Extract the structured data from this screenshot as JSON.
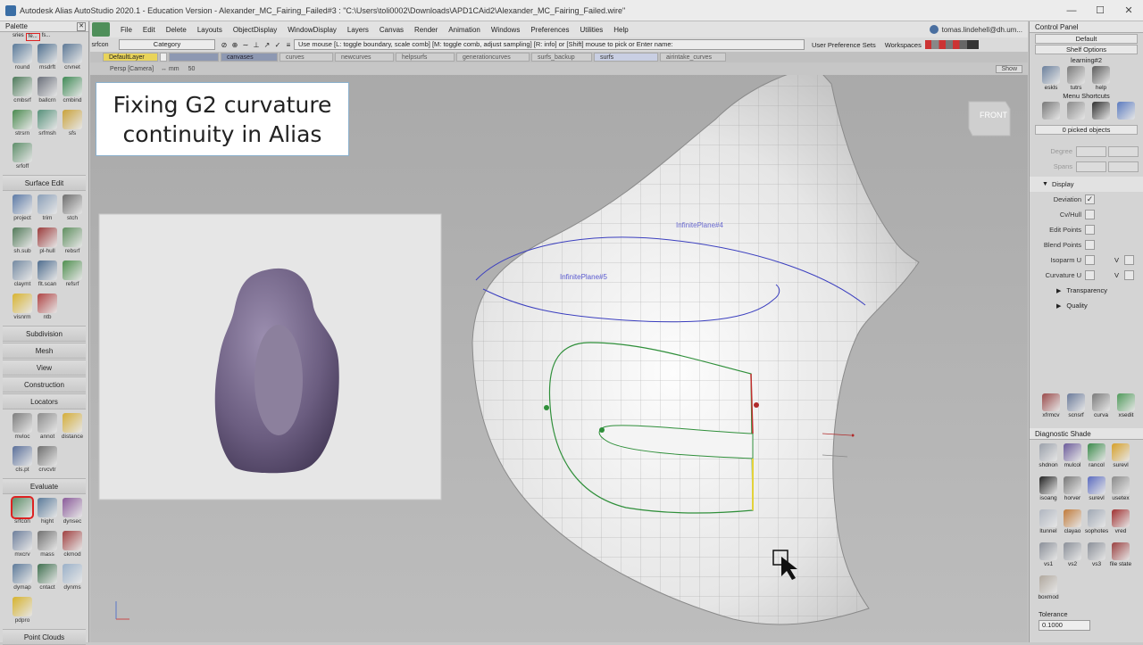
{
  "window": {
    "title": "Autodesk Alias AutoStudio 2020.1 - Education Version   - Alexander_MC_Fairing_Failed#3 : \"C:\\Users\\toli0002\\Downloads\\APD1CAid2\\Alexander_MC_Fairing_Failed.wire\"",
    "controls": [
      "—",
      "☐",
      "✕"
    ]
  },
  "menubar": {
    "items": [
      "File",
      "Edit",
      "Delete",
      "Layouts",
      "ObjectDisplay",
      "WindowDisplay",
      "Layers",
      "Canvas",
      "Render",
      "Animation",
      "Windows",
      "Preferences",
      "Utilities",
      "Help"
    ],
    "user": "tomas.lindehell@dh.um..."
  },
  "status": {
    "tool_label": "srfcon",
    "category": "Category",
    "prompt": "Use mouse [L: toggle boundary, scale comb] [M: toggle comb, adjust sampling] [R: info] or [Shift] mouse to pick or Enter name:",
    "user_prefs": "User Preference Sets",
    "workspaces": "Workspaces"
  },
  "layers": {
    "items": [
      "DefaultLayer",
      "",
      "canvases",
      "curves",
      "newcurves",
      "helpsurfs",
      "generationcurves",
      "surfs_backup",
      "surfs",
      "airintake_curves"
    ]
  },
  "viewport": {
    "name": "Persp [Camera]",
    "units": "↔ mm",
    "zoom": "50",
    "show": "Show",
    "view_cube": "FRONT",
    "plane_labels": [
      "InfinitePlane#4",
      "InfinitePlane#5"
    ],
    "caption": "Fixing G2 curvature\ncontinuity in Alias"
  },
  "palette": {
    "title": "Palette",
    "top_tabs": [
      "sries",
      "fe...",
      "fs..."
    ],
    "group1": [
      {
        "label": "round",
        "color": "#5a7a9a"
      },
      {
        "label": "msdrft",
        "color": "#4f6f8f"
      },
      {
        "label": "crvnet",
        "color": "#5c7896"
      },
      {
        "label": "cmbsrf",
        "color": "#4d7a5a"
      },
      {
        "label": "ballcrn",
        "color": "#6a6f7a"
      },
      {
        "label": "cmbind",
        "color": "#3f8a55"
      },
      {
        "label": "strsrn",
        "color": "#4a8a4f"
      },
      {
        "label": "srfmsh",
        "color": "#56917a"
      },
      {
        "label": "sfs",
        "color": "#c9a23a"
      },
      {
        "label": "srfoff",
        "color": "#5e8f6a"
      }
    ],
    "sections": [
      "Surface Edit",
      "Subdivision",
      "Mesh",
      "View",
      "Construction",
      "Locators",
      "Evaluate",
      "Point Clouds"
    ],
    "surface_edit": [
      {
        "label": "project",
        "color": "#5b79a6"
      },
      {
        "label": "trim",
        "color": "#8a9fb8"
      },
      {
        "label": "stch",
        "color": "#6d6d6d"
      },
      {
        "label": "sh.sub",
        "color": "#527a59"
      },
      {
        "label": "pl-hull",
        "color": "#9b3b3b"
      },
      {
        "label": "rebsrf",
        "color": "#5f8f5f"
      },
      {
        "label": "claymt",
        "color": "#748aa2"
      },
      {
        "label": "flt.scan",
        "color": "#4e6c8e"
      },
      {
        "label": "refsrf",
        "color": "#4f8f4f"
      },
      {
        "label": "visnrm",
        "color": "#d8b330"
      },
      {
        "label": "ntb",
        "color": "#b04444"
      }
    ],
    "locators": [
      {
        "label": "mvloc",
        "color": "#7d7d7d"
      },
      {
        "label": "annot",
        "color": "#8c8c8c"
      },
      {
        "label": "distance",
        "color": "#d4ad38"
      },
      {
        "label": "cls.pt",
        "color": "#5a6f9a"
      },
      {
        "label": "crvcvtr",
        "color": "#6e6e6e"
      }
    ],
    "evaluate": [
      {
        "label": "srfcon",
        "color": "#5f8f6a",
        "selected": true
      },
      {
        "label": "hight",
        "color": "#5a7a9a"
      },
      {
        "label": "dynsec",
        "color": "#8a5a9a"
      },
      {
        "label": "mxcrv",
        "color": "#6d7f9c"
      },
      {
        "label": "mass",
        "color": "#707070"
      },
      {
        "label": "ckmod",
        "color": "#a04040"
      },
      {
        "label": "dymap",
        "color": "#5d7a9a"
      },
      {
        "label": "cntact",
        "color": "#3f6f4f"
      },
      {
        "label": "dynms",
        "color": "#9ab0c8"
      },
      {
        "label": "pdpro",
        "color": "#d6b22c"
      }
    ]
  },
  "control_panel": {
    "title": "Control Panel",
    "default": "Default",
    "shelf_options": "Shelf Options",
    "shelf_name": "learning#2",
    "shelf_tools": [
      {
        "label": "eskls",
        "color": "#6a7f9c"
      },
      {
        "label": "tutrs",
        "color": "#7a7a7a"
      },
      {
        "label": "help",
        "color": "#5c5c5c"
      }
    ],
    "menu_shortcuts": "Menu Shortcuts",
    "shortcuts": [
      {
        "color": "#777777"
      },
      {
        "color": "#8a8a8a"
      },
      {
        "color": "#2f2f2f"
      },
      {
        "color": "#5a7abf"
      }
    ],
    "picked": "0 picked objects",
    "degree": "Degree",
    "spans": "Spans",
    "display": "Display",
    "display_rows": [
      {
        "label": "Deviation",
        "checked": true
      },
      {
        "label": "Cv/Hull",
        "checked": false
      },
      {
        "label": "Edit Points",
        "checked": false
      },
      {
        "label": "Blend Points",
        "checked": false
      },
      {
        "label": "Isoparm U",
        "checked": false,
        "v": "V"
      },
      {
        "label": "Curvature U",
        "checked": false,
        "v": "V"
      }
    ],
    "transparency": "Transparency",
    "quality": "Quality",
    "bottom_tools": [
      {
        "label": "xfrmcv",
        "color": "#9a4a4a"
      },
      {
        "label": "scnsrf",
        "color": "#6a7a9a"
      },
      {
        "label": "curva",
        "color": "#7a7a7a"
      },
      {
        "label": "xsedit",
        "color": "#4f9a5a"
      }
    ]
  },
  "diagnostic_shade": {
    "title": "Diagnostic Shade",
    "tools": [
      {
        "label": "shdnon",
        "color": "#9aa0aa"
      },
      {
        "label": "mulcol",
        "color": "#6a5a9a"
      },
      {
        "label": "rancol",
        "color": "#3a8a4a"
      },
      {
        "label": "surevl",
        "color": "#d6a028"
      },
      {
        "label": "isoang",
        "color": "#222222"
      },
      {
        "label": "horver",
        "color": "#777777"
      },
      {
        "label": "surevl",
        "color": "#5a6abf"
      },
      {
        "label": "usetex",
        "color": "#8a8a8a"
      },
      {
        "label": "ltunnel",
        "color": "#b0b6c0"
      },
      {
        "label": "clayao",
        "color": "#c07a3a"
      },
      {
        "label": "sophotes",
        "color": "#a0a8b4"
      },
      {
        "label": "vred",
        "color": "#a03030"
      },
      {
        "label": "vs1",
        "color": "#8a8f98"
      },
      {
        "label": "vs2",
        "color": "#8a8f98"
      },
      {
        "label": "vs3",
        "color": "#8a8f98"
      },
      {
        "label": "file state",
        "color": "#9a4040"
      },
      {
        "label": "boxmod",
        "color": "#b0a89e"
      }
    ],
    "tolerance_label": "Tolerance",
    "tolerance_value": "0.1000"
  }
}
